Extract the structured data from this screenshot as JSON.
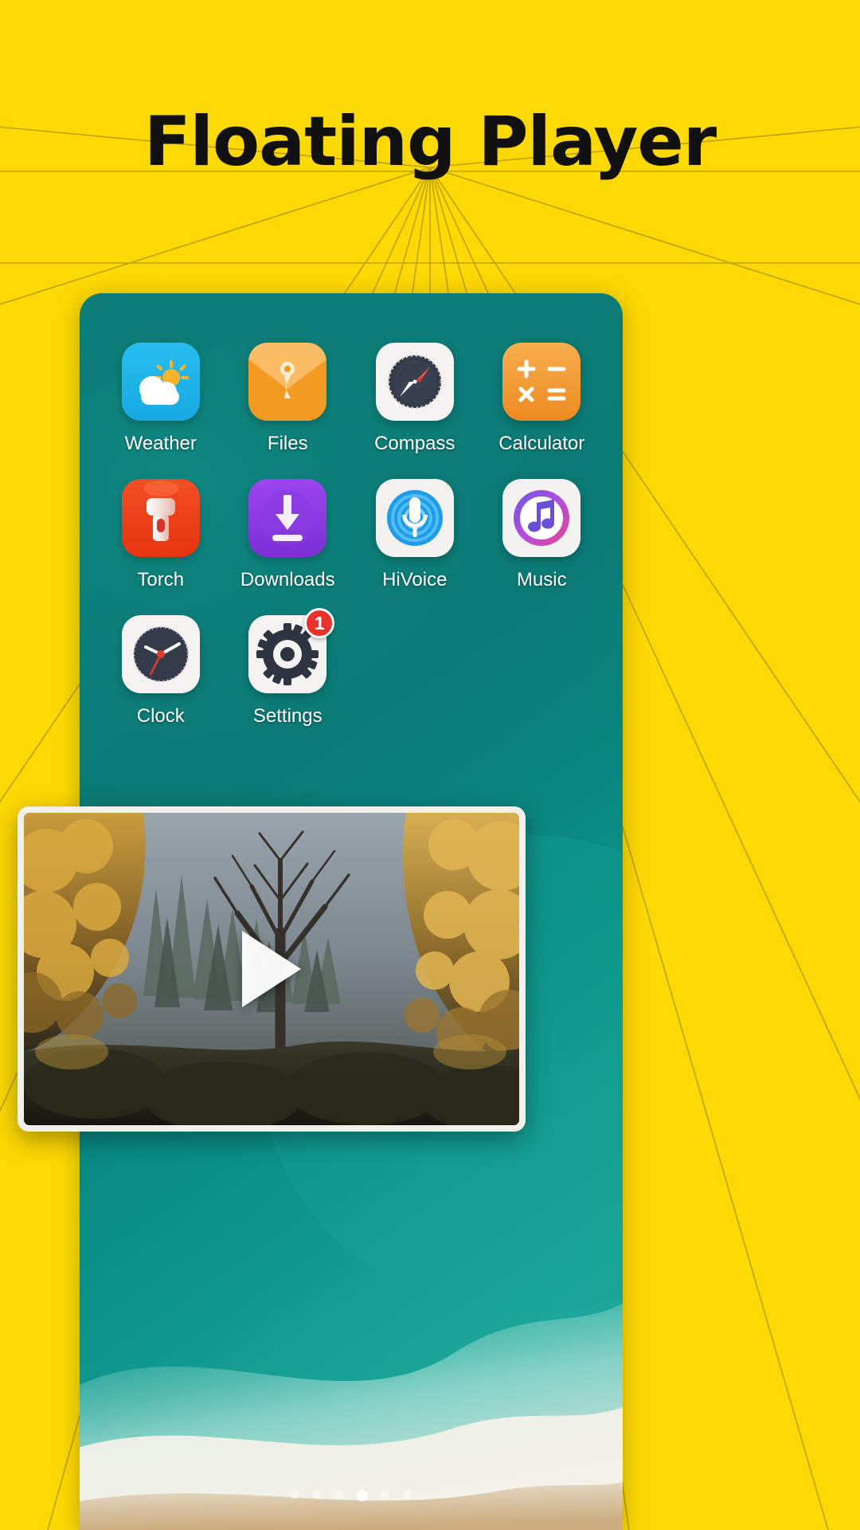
{
  "header": {
    "title": "Floating Player"
  },
  "theme": {
    "background": "#FCD804",
    "sunburst_line": "#8a7703",
    "title_color": "#111111",
    "wallpaper_teal": "#0b7b76",
    "wallpaper_teal_dark": "#07625f",
    "badge_color": "#E8332B",
    "label_color": "#FFFFFF"
  },
  "phone": {
    "apps": [
      {
        "label": "Weather",
        "icon": "weather-icon",
        "badge": null
      },
      {
        "label": "Files",
        "icon": "files-icon",
        "badge": null
      },
      {
        "label": "Compass",
        "icon": "compass-icon",
        "badge": null
      },
      {
        "label": "Calculator",
        "icon": "calculator-icon",
        "badge": null
      },
      {
        "label": "Torch",
        "icon": "torch-icon",
        "badge": null
      },
      {
        "label": "Downloads",
        "icon": "downloads-icon",
        "badge": null
      },
      {
        "label": "HiVoice",
        "icon": "hivoice-icon",
        "badge": null
      },
      {
        "label": "Music",
        "icon": "music-icon",
        "badge": null
      },
      {
        "label": "Clock",
        "icon": "clock-icon",
        "badge": null
      },
      {
        "label": "Settings",
        "icon": "settings-icon",
        "badge": "1"
      }
    ],
    "page_dots": {
      "count": 6,
      "active_index": 3
    }
  },
  "player": {
    "play_icon": "play-triangle-icon",
    "thumbnail": "autumn-forest-video-thumbnail"
  }
}
